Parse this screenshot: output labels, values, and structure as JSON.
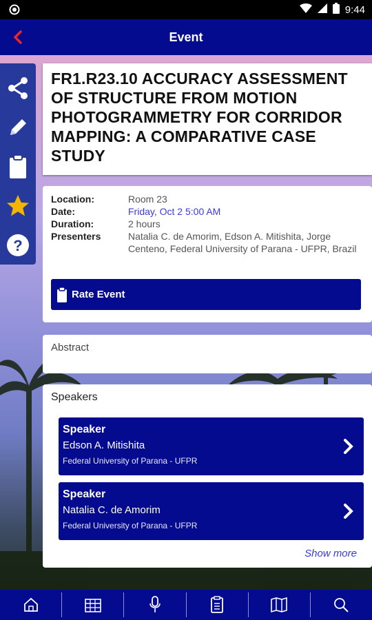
{
  "status_bar": {
    "time": "9:44"
  },
  "app_bar": {
    "title": "Event"
  },
  "side_tools": [
    "share-icon",
    "pencil-icon",
    "clipboard-icon",
    "star-icon",
    "help-icon"
  ],
  "event": {
    "title": "FR1.R23.10 ACCURACY ASSESSMENT OF STRUCTURE FROM MOTION PHOTOGRAMMETRY FOR CORRIDOR MAPPING: A COMPARATIVE CASE STUDY",
    "location_label": "Location:",
    "location": "Room 23",
    "date_label": "Date:",
    "date": "Friday, Oct 2 5:00 AM",
    "duration_label": "Duration:",
    "duration": "2 hours",
    "presenters_label": "Presenters",
    "presenters": "Natalia C. de Amorim, Edson A. Mitishita, Jorge Centeno, Federal University of Parana - UFPR, Brazil",
    "rate_label": "Rate Event"
  },
  "abstract": {
    "label": "Abstract"
  },
  "speakers": {
    "heading": "Speakers",
    "items": [
      {
        "kind": "Speaker",
        "name": "Edson A. Mitishita",
        "org": "Federal University of Parana - UFPR"
      },
      {
        "kind": "Speaker",
        "name": "Natalia C. de Amorim",
        "org": "Federal University of Parana - UFPR"
      }
    ],
    "show_more": "Show more"
  },
  "bottom_nav": [
    "home-icon",
    "schedule-icon",
    "microphone-icon",
    "document-icon",
    "map-icon",
    "search-icon"
  ],
  "colors": {
    "primary": "#040b8e",
    "accent": "#e8262a",
    "link": "#3a3adf",
    "star": "#f5b400"
  }
}
